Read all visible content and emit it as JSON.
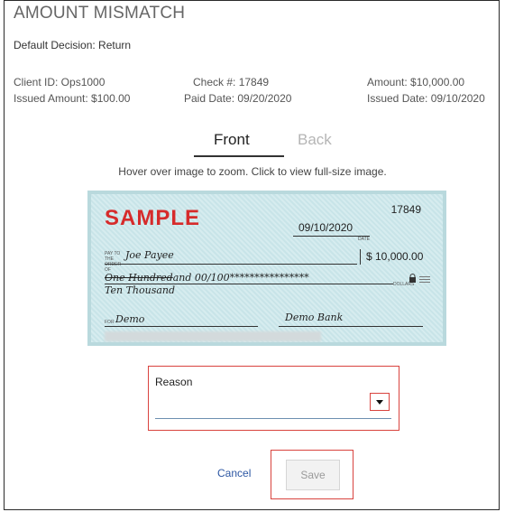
{
  "header": {
    "title": "AMOUNT MISMATCH",
    "default_decision": "Default Decision:  Return"
  },
  "info": {
    "client_id": "Client ID:  Ops1000",
    "check_no": "Check #:  17849",
    "amount": "Amount:  $10,000.00",
    "issued_amount": "Issued Amount:  $100.00",
    "paid_date": "Paid Date: 09/20/2020",
    "issued_date": "Issued Date:  09/10/2020"
  },
  "tabs": [
    {
      "label": "Front",
      "active": true
    },
    {
      "label": "Back",
      "active": false
    }
  ],
  "hover_hint": "Hover over image to zoom. Click to view full-size image.",
  "check": {
    "sample_label": "SAMPLE",
    "number": "17849",
    "date": "09/10/2020",
    "date_caption": "DATE",
    "payto_caption": "PAY TO THE ORDER OF",
    "payee": "Joe Payee",
    "amount": "$ 10,000.00",
    "words_struck": "One Hundred",
    "words_rest": "and 00/100****************",
    "dollars_caption": "DOLLARS",
    "words_correction": "Ten Thousand",
    "memo_caption": "FOR",
    "memo": "Demo",
    "signature": "Demo Bank"
  },
  "reason": {
    "label": "Reason",
    "value": ""
  },
  "actions": {
    "cancel_label": "Cancel",
    "save_label": "Save"
  },
  "colors": {
    "highlight_border": "#d9433e",
    "link": "#2d57a3",
    "sample_red": "#d62b2b"
  }
}
